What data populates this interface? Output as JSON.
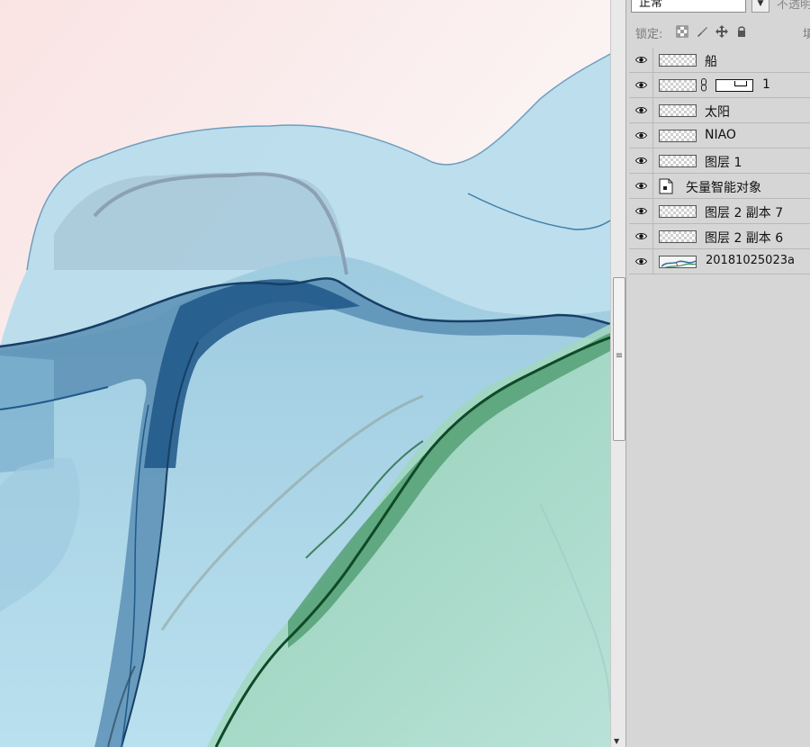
{
  "panel": {
    "blend_mode": "正常",
    "opacity_label": "不透明",
    "lock_label": "锁定:",
    "fill_label": "填",
    "lock_icons": [
      "lock-transparent-pixels-icon",
      "lock-image-pixels-icon",
      "lock-position-icon",
      "lock-all-icon"
    ]
  },
  "layers": [
    {
      "name": "船",
      "visible": true,
      "thumb": "transparent"
    },
    {
      "name": "1",
      "visible": true,
      "thumb": "transparent",
      "has_mask": true
    },
    {
      "name": "太阳",
      "visible": true,
      "thumb": "transparent"
    },
    {
      "name": "NIAO",
      "visible": true,
      "thumb": "transparent"
    },
    {
      "name": "图层 1",
      "visible": true,
      "thumb": "transparent"
    },
    {
      "name": "矢量智能对象",
      "visible": true,
      "thumb": "smart-object"
    },
    {
      "name": "图层 2 副本 7",
      "visible": true,
      "thumb": "transparent"
    },
    {
      "name": "图层 2 副本 6",
      "visible": true,
      "thumb": "transparent"
    },
    {
      "name": "20181025023a",
      "visible": true,
      "thumb": "image"
    }
  ],
  "colors": {
    "panel_bg": "#d6d6d6",
    "ink_dark_blue": "#1a4e7c",
    "ink_light_blue": "#a9d6ea",
    "ink_green": "#2f7a4a",
    "paper_pink": "#f9e4e4"
  }
}
